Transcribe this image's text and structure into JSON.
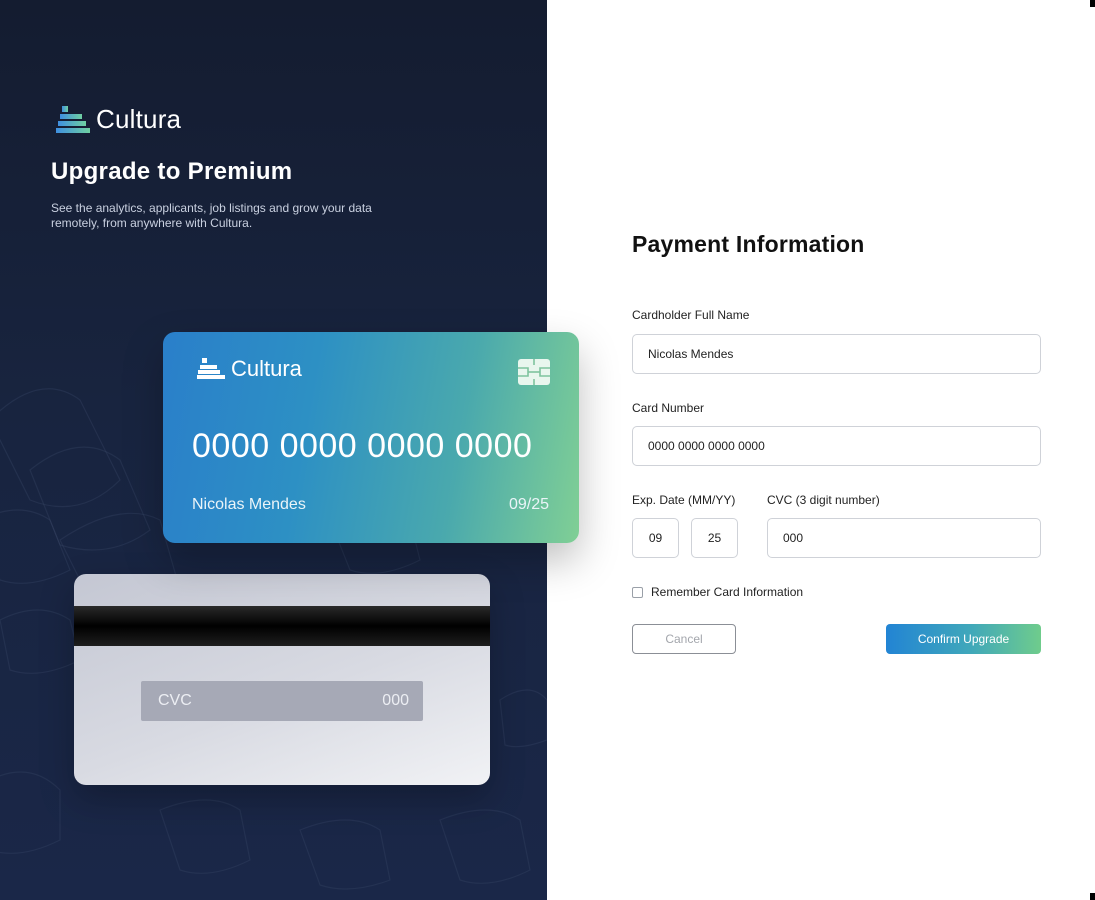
{
  "brand": {
    "name": "Cultura",
    "logo_icon": "cultura-logo-icon"
  },
  "promo": {
    "title": "Upgrade to Premium",
    "description": "See the analytics, applicants, job listings and grow your data remotely, from anywhere with Cultura."
  },
  "card_front": {
    "brand_name": "Cultura",
    "number": "0000 0000 0000 0000",
    "holder": "Nicolas Mendes",
    "expiry": "09/25",
    "chip_icon": "card-chip-icon"
  },
  "card_back": {
    "cvc_label": "CVC",
    "cvc_value": "000"
  },
  "form": {
    "title": "Payment Information",
    "cardholder_label": "Cardholder Full Name",
    "cardholder_value": "Nicolas Mendes",
    "card_number_label": "Card Number",
    "card_number_value": "0000 0000 0000 0000",
    "exp_label": "Exp. Date (MM/YY)",
    "exp_month": "09",
    "exp_year": "25",
    "cvc_label": "CVC (3 digit number)",
    "cvc_value": "000",
    "remember_label": "Remember Card Information",
    "remember_checked": false,
    "cancel_label": "Cancel",
    "confirm_label": "Confirm Upgrade"
  },
  "colors": {
    "left_panel": "#18243f",
    "accent_blue": "#2284d4",
    "accent_green": "#6fcc8c",
    "back_card": "#d8dae2"
  }
}
